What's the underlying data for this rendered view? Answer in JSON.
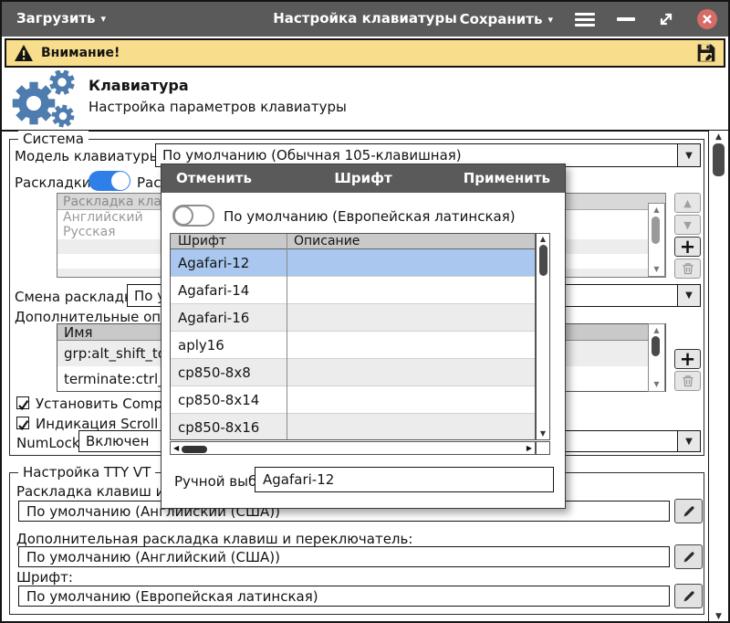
{
  "titlebar": {
    "load": "Загрузить",
    "title": "Настройка клавиатуры",
    "save": "Сохранить"
  },
  "warning": {
    "text": "Внимание!"
  },
  "header": {
    "title": "Клавиатура",
    "subtitle": "Настройка параметров клавиатуры"
  },
  "system": {
    "legend": "Система",
    "model_label": "Модель клавиатуры:",
    "model_value": "По умолчанию (Обычная 105-клавишная)",
    "layouts_label": "Раскладки:",
    "layouts_caption_fragment": "Раскл",
    "layouts_list": {
      "header": "Раскладка клавиатуры",
      "rows": [
        "Английский",
        "Русская"
      ]
    },
    "switch_label": "Смена раскладки:",
    "switch_value_fragment": "По ум",
    "options_label": "Дополнительные опции:",
    "options_list": {
      "header": "Имя",
      "rows": [
        "grp:alt_shift_toggle",
        "terminate:ctrl_alt_bksp"
      ]
    },
    "compose_checkbox_fragment": "Установить Compose",
    "scrolllock_checkbox_fragment": "Индикация Scroll Lock",
    "numlock_label": "NumLock:",
    "numlock_value": "Включен"
  },
  "tty": {
    "legend": "Настройка TTY VT",
    "layout_label_fragment": "Раскладка клавиш и пер",
    "layout_value": "По умолчанию (Английский (США))",
    "extra_layout_label": "Дополнительная раскладка клавиш и переключатель:",
    "extra_layout_value": "По умолчанию (Английский (США))",
    "font_label": "Шрифт:",
    "font_value": "По умолчанию (Европейская латинская)"
  },
  "font_dialog": {
    "cancel": "Отменить",
    "title": "Шрифт",
    "apply": "Применить",
    "default_toggle": "По умолчанию (Европейская латинская)",
    "col_font": "Шрифт",
    "col_desc": "Описание",
    "fonts": [
      "Agafari-12",
      "Agafari-14",
      "Agafari-16",
      "aply16",
      "cp850-8x8",
      "cp850-8x14",
      "cp850-8x16"
    ],
    "selected_font": "Agafari-12",
    "manual_label": "Ручной выбор:",
    "manual_value": "Agafari-12"
  },
  "colors": {
    "titlebar_bg": "#5a5a5a",
    "warning_bg": "#f8dd8c",
    "accent_blue": "#2f7fe8",
    "gear_blue": "#4e7cae",
    "selected_row": "#a9c7ef",
    "close_red": "#d76b67"
  }
}
